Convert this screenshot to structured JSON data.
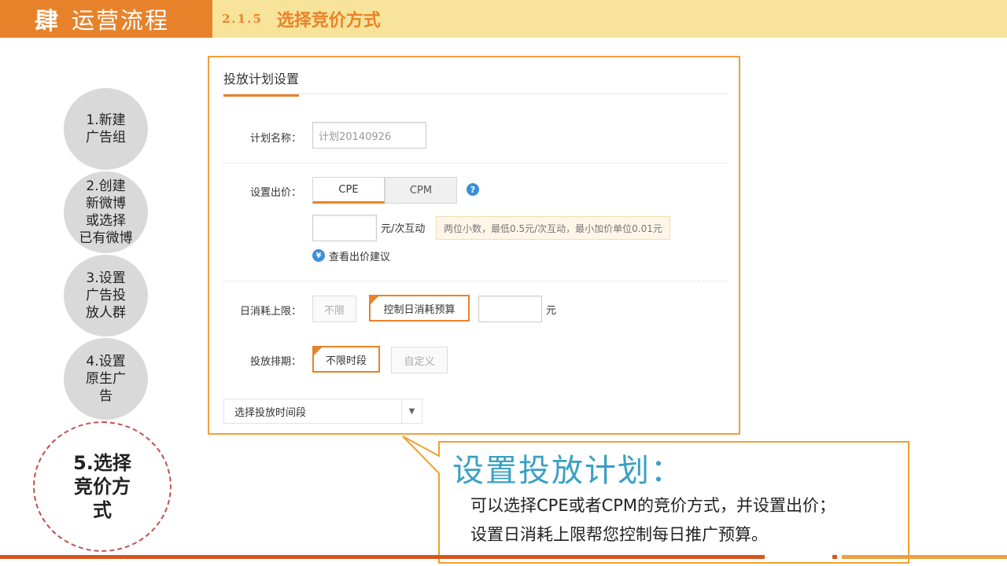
{
  "header": {
    "section_number": "肆",
    "section_title": "运营流程",
    "subsection_number": "2.1.5",
    "subsection_title": "选择竞价方式"
  },
  "steps": [
    {
      "label": "1.新建\n广告组"
    },
    {
      "label": "2.创建\n新微博\n或选择\n已有微博"
    },
    {
      "label": "3.设置\n广告投\n放人群"
    },
    {
      "label": "4.设置\n原生广\n告"
    },
    {
      "label": "5.选择\n竞价方\n式",
      "active": true
    }
  ],
  "form": {
    "title": "投放计划设置",
    "plan_name_label": "计划名称：",
    "plan_name_value": "计划20140926",
    "bid_label": "设置出价：",
    "bid_tabs": [
      "CPE",
      "CPM"
    ],
    "bid_unit": "元/次互动",
    "bid_hint": "两位小数，最低0.5元/次互动，最小加价单位0.01元",
    "bid_suggest_link": "查看出价建议",
    "daily_limit_label": "日消耗上限：",
    "daily_limit_options": [
      "不限",
      "控制日消耗预算"
    ],
    "daily_limit_unit": "元",
    "schedule_label": "投放排期：",
    "schedule_options": [
      "不限时段",
      "自定义"
    ],
    "time_select_label": "选择投放时间段"
  },
  "callout": {
    "title": "设置投放计划：",
    "line1": "可以选择CPE或者CPM的竞价方式，并设置出价；",
    "line2": "设置日消耗上限帮您控制每日推广预算。"
  },
  "colors": {
    "orange": "#e8822a",
    "header_yellow": "#f7e49a",
    "callout_blue": "#3aa0c4",
    "bottom_red": "#d9541e"
  }
}
